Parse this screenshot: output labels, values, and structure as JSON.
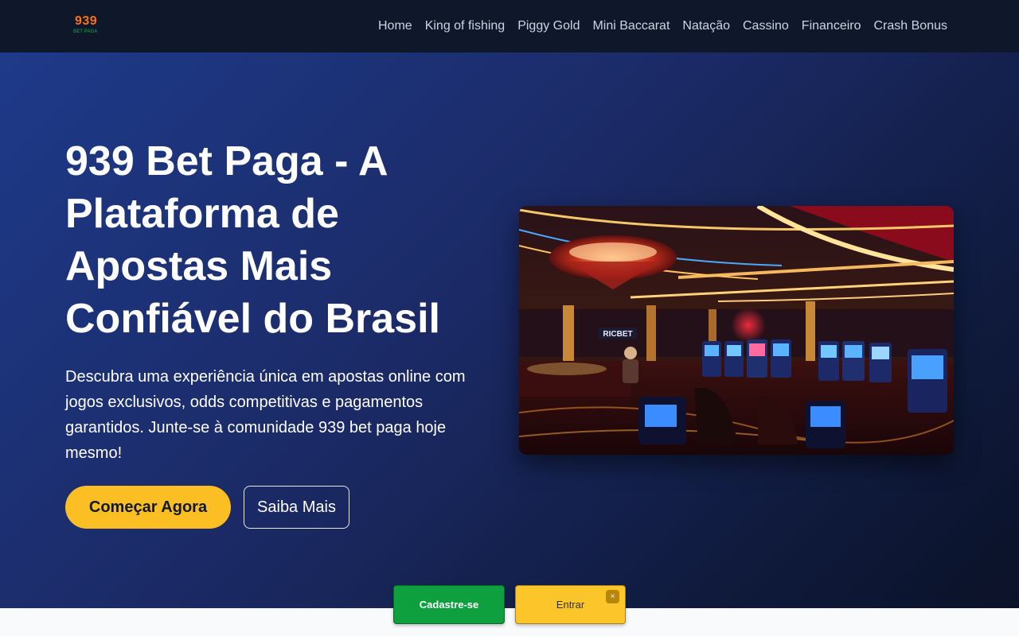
{
  "header": {
    "logo_text": "939",
    "logo_subtext": "BET PAGA",
    "nav": [
      {
        "label": "Home"
      },
      {
        "label": "King of fishing"
      },
      {
        "label": "Piggy Gold"
      },
      {
        "label": "Mini Baccarat"
      },
      {
        "label": "Natação"
      },
      {
        "label": "Cassino"
      },
      {
        "label": "Financeiro"
      },
      {
        "label": "Crash Bonus"
      }
    ]
  },
  "hero": {
    "title": "939 Bet Paga - A Plataforma de Apostas Mais Confiável do Brasil",
    "description": "Descubra uma experiência única em apostas online com jogos exclusivos, odds competitivas e pagamentos garantidos. Junte-se à comunidade 939 bet paga hoje mesmo!",
    "primary_button": "Começar Agora",
    "secondary_button": "Saiba Mais",
    "image_sign": "RICBET"
  },
  "floating_cta": {
    "register_label": "Cadastre-se",
    "login_label": "Entrar",
    "close_label": "×"
  },
  "colors": {
    "header_bg": "#0f172a",
    "hero_gradient_start": "#1e3a8a",
    "hero_gradient_end": "#0b1228",
    "accent_yellow": "#fbbf24",
    "register_green": "#0e9f3e",
    "logo_orange": "#f97316"
  }
}
